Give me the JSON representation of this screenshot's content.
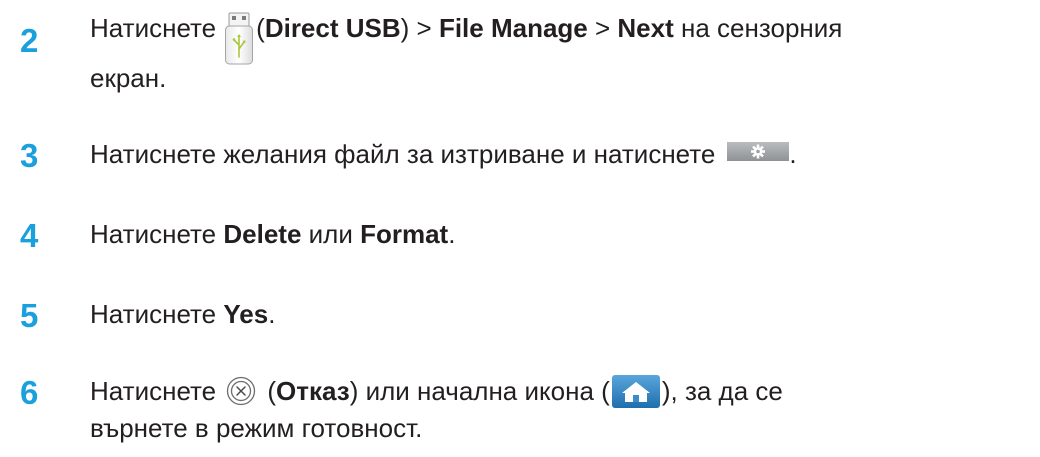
{
  "steps": [
    {
      "number": "2",
      "parts": {
        "pre": "Натиснете",
        "open": "(",
        "b1": "Direct USB",
        "mid1": ") > ",
        "b2": "File Manage",
        "mid2": " > ",
        "b3": "Next",
        "post": " на сензорния",
        "line2": "екран."
      },
      "icon": "usb-drive-icon"
    },
    {
      "number": "3",
      "parts": {
        "pre": "Натиснете желания файл за изтриване и натиснете",
        "post": "."
      },
      "icon": "settings-icon"
    },
    {
      "number": "4",
      "parts": {
        "pre": "Натиснете ",
        "b1": "Delete",
        "mid1": " или ",
        "b2": "Format",
        "post": "."
      }
    },
    {
      "number": "5",
      "parts": {
        "pre": "Натиснете ",
        "b1": "Yes",
        "post": "."
      }
    },
    {
      "number": "6",
      "parts": {
        "pre": "Натиснете",
        "open": " (",
        "b1": "Отказ",
        "mid1": ") или начална икона (",
        "post": "), за да се",
        "line2": "върнете в режим готовност."
      },
      "icons": [
        "cancel-icon",
        "home-icon"
      ]
    }
  ],
  "colors": {
    "step_number": "#1aa0dc",
    "text": "#231f20",
    "home_button": "#2a7fc0"
  }
}
